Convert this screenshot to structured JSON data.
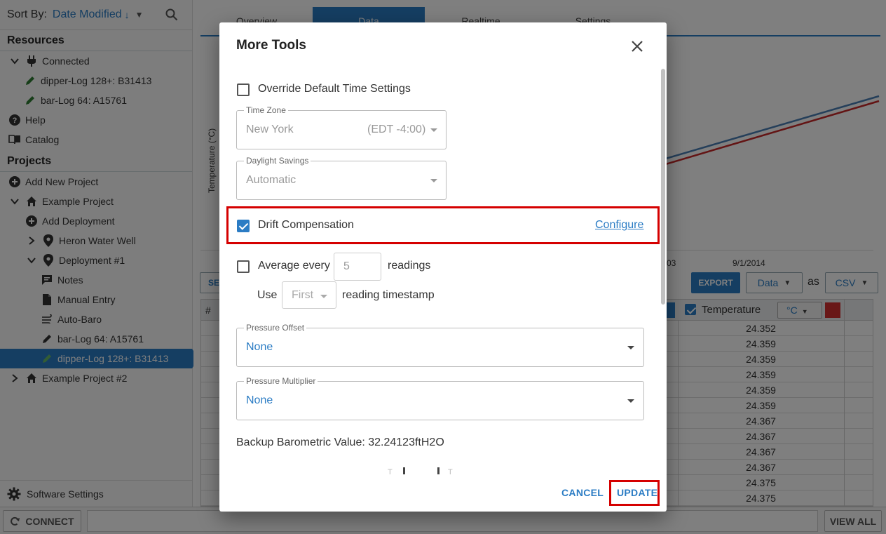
{
  "sidebar": {
    "sort_label": "Sort By:",
    "sort_value": "Date Modified",
    "resources_title": "Resources",
    "connected_label": "Connected",
    "device1": "dipper-Log 128+: B31413",
    "device2": "bar-Log 64: A15761",
    "help": "Help",
    "catalog": "Catalog",
    "projects_title": "Projects",
    "add_new_project": "Add New Project",
    "example_project": "Example Project",
    "add_deployment": "Add Deployment",
    "heron_water_well": "Heron Water Well",
    "deployment1": "Deployment #1",
    "notes": "Notes",
    "manual_entry": "Manual Entry",
    "auto_baro": "Auto-Baro",
    "dep_device1": "bar-Log 64: A15761",
    "dep_device2": "dipper-Log 128+: B31413",
    "example_project2": "Example Project #2",
    "software_settings": "Software Settings"
  },
  "main": {
    "tabs": [
      "Overview",
      "Data",
      "Realtime",
      "Settings"
    ],
    "y_axis_label": "Temperature (°C)",
    "x_tick_partial": "03",
    "x_tick": "9/1/2014",
    "select_partial": "SE",
    "export": "EXPORT",
    "data_select": "Data",
    "as": "as",
    "format_select": "CSV",
    "col_hash": "#",
    "col_temperature": "Temperature",
    "col_unit": "°C",
    "temperature_values": [
      "24.352",
      "24.359",
      "24.359",
      "24.359",
      "24.359",
      "24.359",
      "24.367",
      "24.367",
      "24.367",
      "24.367",
      "24.375",
      "24.375"
    ]
  },
  "bottom": {
    "connect": "CONNECT",
    "view_all": "VIEW ALL"
  },
  "dialog": {
    "title": "More Tools",
    "override_label": "Override Default Time Settings",
    "timezone_label": "Time Zone",
    "timezone_value": "New York",
    "timezone_offset": "(EDT -4:00)",
    "daylight_label": "Daylight Savings",
    "daylight_value": "Automatic",
    "drift_label": "Drift Compensation",
    "configure": "Configure",
    "average_label": "Average every",
    "average_value": "5",
    "readings": "readings",
    "use": "Use",
    "first": "First",
    "reading_timestamp": "reading timestamp",
    "pressure_offset_label": "Pressure Offset",
    "pressure_offset_value": "None",
    "pressure_multiplier_label": "Pressure Multiplier",
    "pressure_multiplier_value": "None",
    "backup_barometric": "Backup Barometric Value: 32.24123ftH2O",
    "cancel": "CANCEL",
    "update": "UPDATE"
  },
  "colors": {
    "accent": "#2b7cc4",
    "highlight": "#d50000",
    "series_blue": "#4a7fb5",
    "series_red": "#c62828"
  }
}
